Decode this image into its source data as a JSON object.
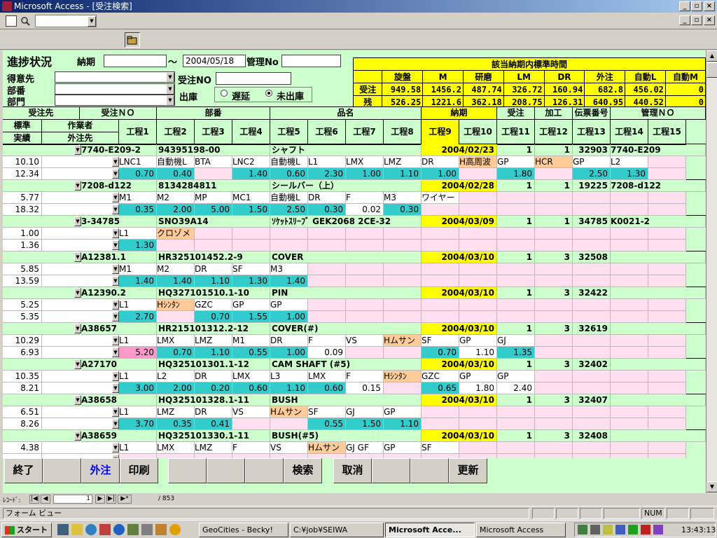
{
  "window": {
    "title": "Microsoft Access - [受注検索]"
  },
  "form": {
    "heading": "進捗状況",
    "noki_label": "納期",
    "noki_from": "",
    "tilde": "～",
    "noki_to": "2004/05/18",
    "kanri_label": "管理No",
    "kanri_value": "",
    "tokui_label": "得意先",
    "buban_label": "部番",
    "bumon_label": "部門",
    "juchu_no_label": "受注NO",
    "shukko_label": "出庫",
    "radio_delay": "遅延",
    "radio_unshipped": "未出庫"
  },
  "std_table": {
    "title": "該当納期内標準時間",
    "headers": [
      "旋盤",
      "M",
      "研磨",
      "LM",
      "DR",
      "外注",
      "自動L",
      "自動M"
    ],
    "rows": [
      {
        "label": "受注",
        "values": [
          "949.58",
          "1456.2",
          "487.74",
          "326.72",
          "160.94",
          "682.8",
          "456.02",
          "0"
        ]
      },
      {
        "label": "残",
        "values": [
          "526.25",
          "1221.6",
          "362.18",
          "208.75",
          "126.31",
          "640.95",
          "440.52",
          "0"
        ]
      }
    ]
  },
  "headers": {
    "row1": [
      "受注先",
      "受注ＮＯ",
      "部番",
      "品名",
      "納期",
      "受注",
      "加工",
      "伝票番号",
      "管理ＮＯ"
    ],
    "std": "標準",
    "worker": "作業者",
    "actual": "実績",
    "outsource": "外注先",
    "steps": [
      "工程1",
      "工程2",
      "工程3",
      "工程4",
      "工程5",
      "工程6",
      "工程7",
      "工程8",
      "工程9",
      "工程10",
      "工程11",
      "工程12",
      "工程13",
      "工程14",
      "工程15"
    ]
  },
  "records": [
    {
      "order_no": "7740-E209-2",
      "part_no": "94395198-00",
      "name": "シャフト",
      "due": "2004/02/23",
      "qty": "1",
      "proc": "1",
      "slip": "32903",
      "mgmt": "7740-E209",
      "std": "10.10",
      "actual": "12.34",
      "steps": [
        "LNC1",
        "自動機L",
        "BTA",
        "LNC2",
        "自動機L",
        "L1",
        "LMX",
        "LMZ",
        "DR",
        "H高周波",
        "GP",
        "HCR",
        "GP",
        "L2",
        ""
      ],
      "times": [
        "0.70",
        "0.40",
        "",
        "1.40",
        "0.60",
        "2.30",
        "1.00",
        "1.10",
        "1.00",
        "",
        "1.80",
        "",
        "2.50",
        "1.30",
        ""
      ]
    },
    {
      "order_no": "7208-d122",
      "part_no": "8134284811",
      "name": "シールバー（上）",
      "due": "2004/02/28",
      "qty": "1",
      "proc": "1",
      "slip": "19225",
      "mgmt": "7208-d122",
      "std": "5.77",
      "actual": "18.32",
      "steps": [
        "M1",
        "M2",
        "MP",
        "MC1",
        "自動機L",
        "DR",
        "F",
        "M3",
        "ワイヤー",
        "",
        "",
        "",
        "",
        "",
        ""
      ],
      "times": [
        "0.35",
        "2.00",
        "5.00",
        "1.50",
        "2.50",
        "0.30",
        "0.02",
        "0.30",
        "",
        "",
        "",
        "",
        "",
        "",
        ""
      ]
    },
    {
      "order_no": "3-34785",
      "part_no": "SNO39A14",
      "name": "ｿｹｯﾄｽﾘｰﾌﾞ GEK2068 2CE-32",
      "due": "2004/03/09",
      "qty": "1",
      "proc": "1",
      "slip": "34785",
      "mgmt": "K0021-2",
      "std": "1.00",
      "actual": "1.36",
      "steps": [
        "L1",
        "クロゾメ",
        "",
        "",
        "",
        "",
        "",
        "",
        "",
        "",
        "",
        "",
        "",
        "",
        ""
      ],
      "times": [
        "1.30",
        "",
        "",
        "",
        "",
        "",
        "",
        "",
        "",
        "",
        "",
        "",
        "",
        "",
        ""
      ]
    },
    {
      "order_no": "A12381.1",
      "part_no": "HR325101452.2-9",
      "name": "COVER",
      "due": "2004/03/10",
      "qty": "1",
      "proc": "3",
      "slip": "32508",
      "mgmt": "",
      "std": "5.85",
      "actual": "13.59",
      "steps": [
        "M1",
        "M2",
        "DR",
        "SF",
        "M3",
        "",
        "",
        "",
        "",
        "",
        "",
        "",
        "",
        "",
        ""
      ],
      "times": [
        "1.40",
        "1.40",
        "1.10",
        "1.30",
        "1.40",
        "",
        "",
        "",
        "",
        "",
        "",
        "",
        "",
        "",
        ""
      ]
    },
    {
      "order_no": "A12390.2",
      "part_no": "HQ327101510.1-10",
      "name": "PIN",
      "due": "2004/03/10",
      "qty": "1",
      "proc": "3",
      "slip": "32422",
      "mgmt": "",
      "std": "5.25",
      "actual": "5.35",
      "steps": [
        "L1",
        "Hｼﾝﾀﾝ",
        "GZC",
        "GP",
        "GP",
        "",
        "",
        "",
        "",
        "",
        "",
        "",
        "",
        "",
        ""
      ],
      "times": [
        "2.70",
        "",
        "0.70",
        "1.55",
        "1.00",
        "",
        "",
        "",
        "",
        "",
        "",
        "",
        "",
        "",
        ""
      ]
    },
    {
      "order_no": "A38657",
      "part_no": "HR215101312.2-12",
      "name": "COVER(#)",
      "due": "2004/03/10",
      "qty": "1",
      "proc": "3",
      "slip": "32619",
      "mgmt": "",
      "std": "10.29",
      "actual": "6.93",
      "steps": [
        "L1",
        "LMX",
        "LMZ",
        "M1",
        "DR",
        "F",
        "VS",
        "Hムサン",
        "SF",
        "GP",
        "GJ",
        "",
        "",
        "",
        ""
      ],
      "times": [
        "5.20",
        "0.70",
        "1.10",
        "0.55",
        "1.00",
        "0.09",
        "",
        "",
        "0.70",
        "1.10",
        "1.35",
        "",
        "",
        "",
        ""
      ]
    },
    {
      "order_no": "A27170",
      "part_no": "HQ325101301.1-12",
      "name": "CAM SHAFT (#5)",
      "due": "2004/03/10",
      "qty": "1",
      "proc": "3",
      "slip": "32402",
      "mgmt": "",
      "std": "10.35",
      "actual": "8.21",
      "steps": [
        "L1",
        "L2",
        "DR",
        "LMX",
        "L3",
        "LMX",
        "F",
        "Hｼﾝﾀﾝ",
        "GZC",
        "GP",
        "GP",
        "",
        "",
        "",
        ""
      ],
      "times": [
        "3.00",
        "2.00",
        "0.20",
        "0.60",
        "1.10",
        "0.60",
        "0.15",
        "",
        "0.65",
        "1.80",
        "2.40",
        "",
        "",
        "",
        ""
      ]
    },
    {
      "order_no": "A38658",
      "part_no": "HQ325101328.1-11",
      "name": "BUSH",
      "due": "2004/03/10",
      "qty": "1",
      "proc": "3",
      "slip": "32407",
      "mgmt": "",
      "std": "6.51",
      "actual": "8.26",
      "steps": [
        "L1",
        "LMZ",
        "DR",
        "VS",
        "Hムサン",
        "SF",
        "GJ",
        "GP",
        "",
        "",
        "",
        "",
        "",
        "",
        ""
      ],
      "times": [
        "3.70",
        "0.35",
        "0.41",
        "",
        "",
        "0.55",
        "1.50",
        "1.10",
        "",
        "",
        "",
        "",
        "",
        "",
        ""
      ]
    },
    {
      "order_no": "A38659",
      "part_no": "HQ325101330.1-11",
      "name": "BUSH(#5)",
      "due": "2004/03/10",
      "qty": "1",
      "proc": "3",
      "slip": "32408",
      "mgmt": "",
      "std": "4.38",
      "actual": "",
      "steps": [
        "L1",
        "LMX",
        "LMZ",
        "F",
        "VS",
        "Hムサン",
        "GJ GF",
        "GP",
        "SF",
        "",
        "",
        "",
        "",
        "",
        ""
      ],
      "times": [
        "",
        "",
        "",
        "",
        "",
        "",
        "",
        "",
        "",
        "",
        "",
        "",
        "",
        "",
        ""
      ]
    }
  ],
  "buttons": {
    "end": "終了",
    "outsource": "外注",
    "print": "印刷",
    "search": "検索",
    "cancel": "取消",
    "update": "更新"
  },
  "nav": {
    "label": "ﾚｺｰﾄﾞ:",
    "current": "1",
    "total": "/ 853"
  },
  "status": {
    "text": "フォーム ビュー",
    "num": "NUM"
  },
  "taskbar": {
    "start": "スタート",
    "tasks": [
      "GeoCities - Becky!",
      "C:¥job¥SEIWA",
      "Microsoft Acce...",
      "Microsoft Access"
    ],
    "clock": "13:43:13"
  }
}
